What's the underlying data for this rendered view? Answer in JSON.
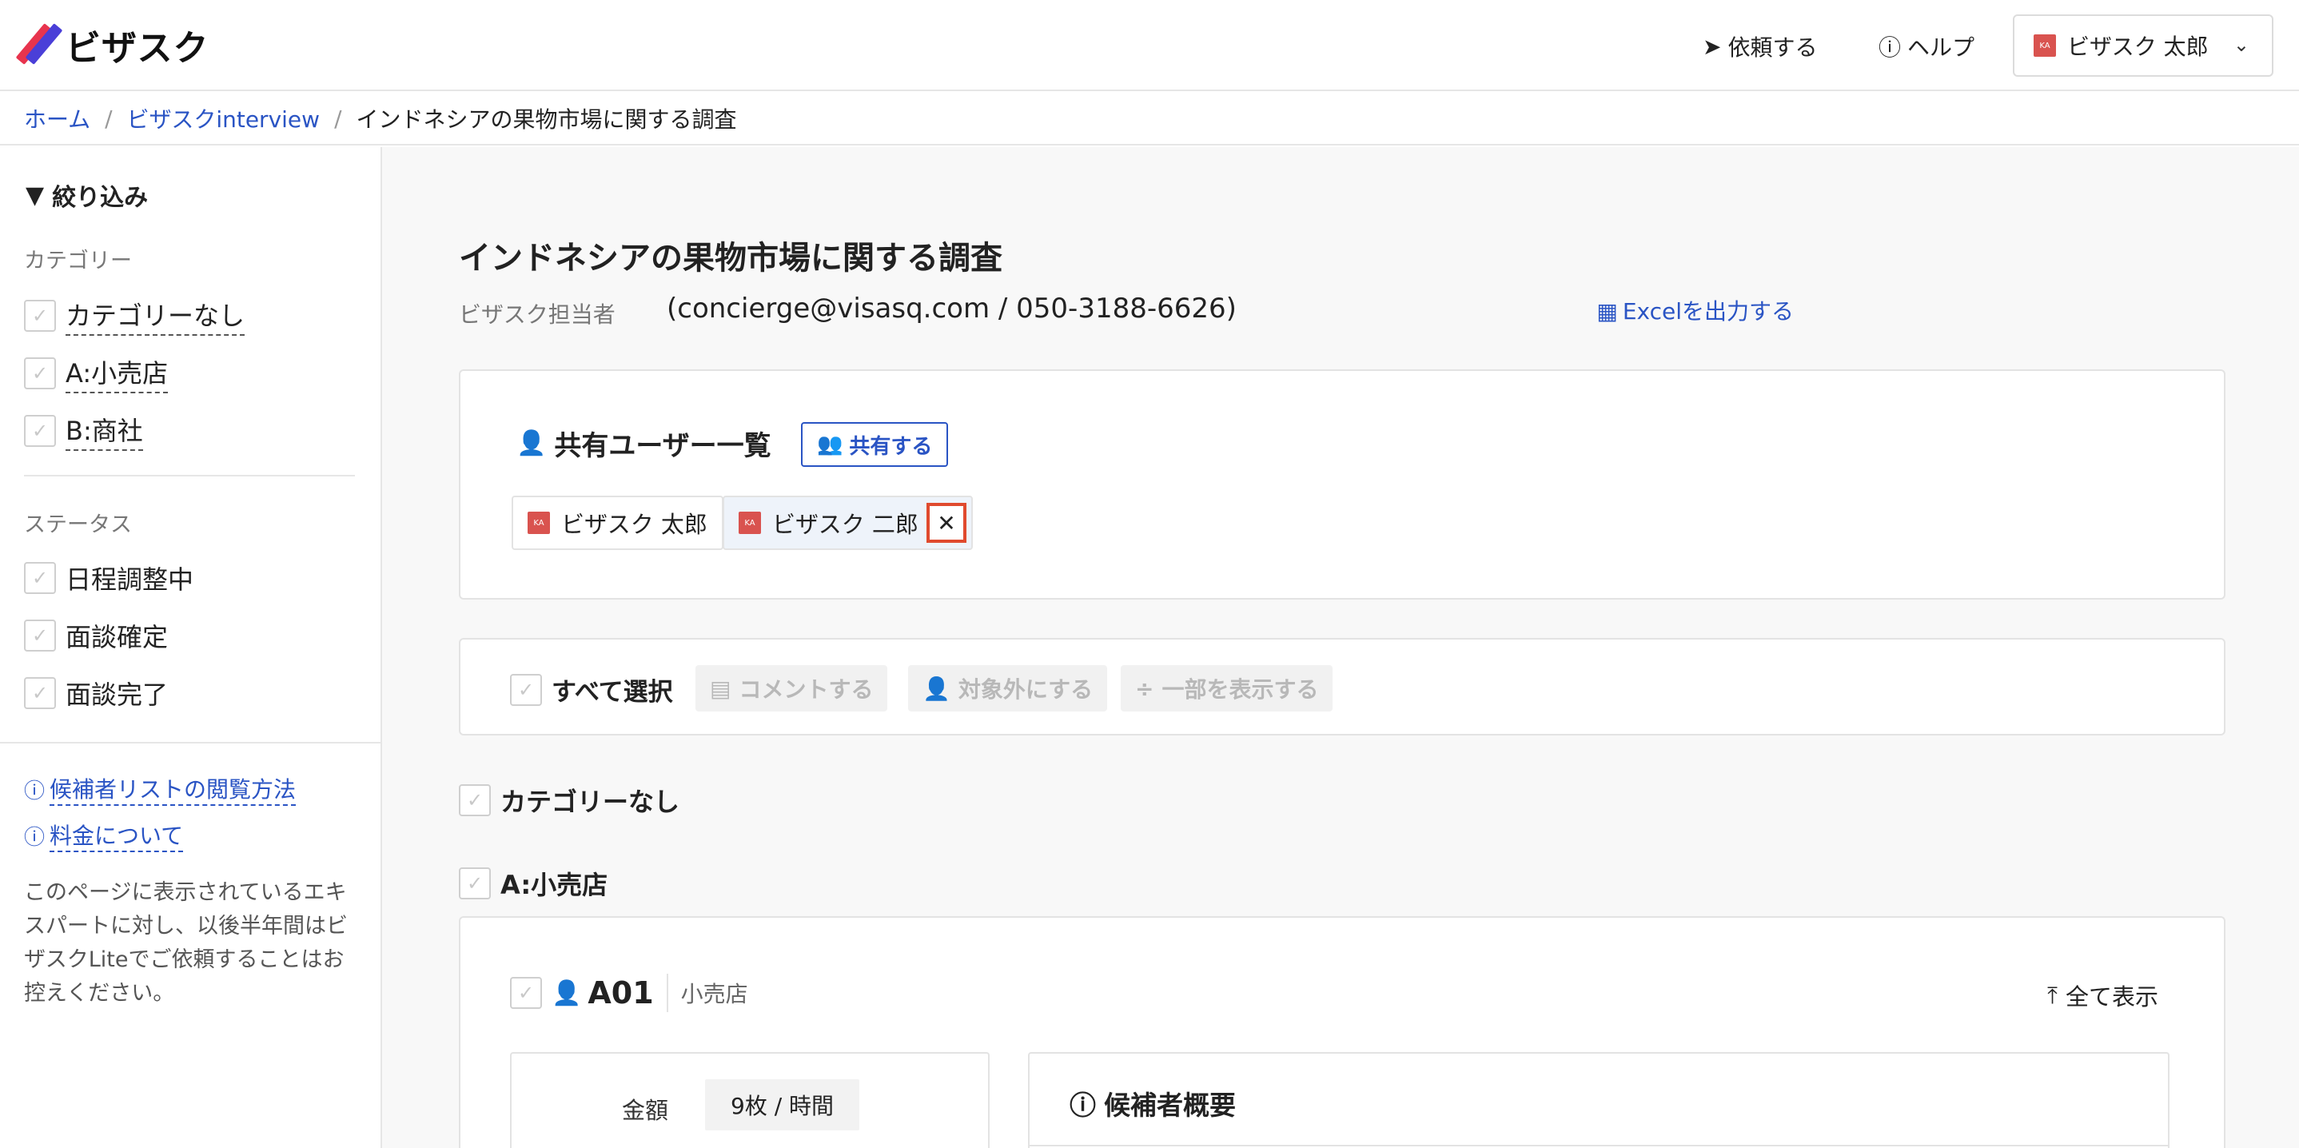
{
  "header": {
    "logo_text": "ビザスク",
    "request_label": "依頼する",
    "help_label": "ヘルプ",
    "user_name": "ビザスク 太郎",
    "avatar_initials": "KA"
  },
  "breadcrumb": {
    "home": "ホーム",
    "parent": "ビザスクinterview",
    "current": "インドネシアの果物市場に関する調査"
  },
  "sidebar": {
    "title": "絞り込み",
    "category_heading": "カテゴリー",
    "categories": [
      "カテゴリーなし",
      "A:小売店",
      "B:商社"
    ],
    "status_heading": "ステータス",
    "statuses": [
      "日程調整中",
      "面談確定",
      "面談完了"
    ],
    "help_links": [
      "候補者リストの閲覧方法",
      "料金について"
    ],
    "note": "このページに表示されているエキスパートに対し、以後半年間はビザスクLiteでご依頼することはお控えください。"
  },
  "main": {
    "title": "インドネシアの果物市場に関する調査",
    "contact_label": "ビザスク担当者",
    "contact_value": "(concierge@visasq.com / 050-3188-6626)",
    "excel_label": "Excelを出力する",
    "share": {
      "title": "共有ユーザー一覧",
      "share_button": "共有する",
      "users": [
        {
          "initials": "KA",
          "name": "ビザスク 太郎"
        },
        {
          "initials": "KA",
          "name": "ビザスク 二郎"
        }
      ]
    },
    "actions": {
      "select_all": "すべて選択",
      "comment": "コメントする",
      "exclude": "対象外にする",
      "show_part": "一部を表示する"
    },
    "category_rows": [
      "カテゴリーなし",
      "A:小売店"
    ],
    "expert": {
      "id": "A01",
      "category": "小売店",
      "show_all": "全て表示",
      "price_label": "金額",
      "price_value": "9枚 / 時間",
      "summary_title": "候補者概要"
    }
  }
}
